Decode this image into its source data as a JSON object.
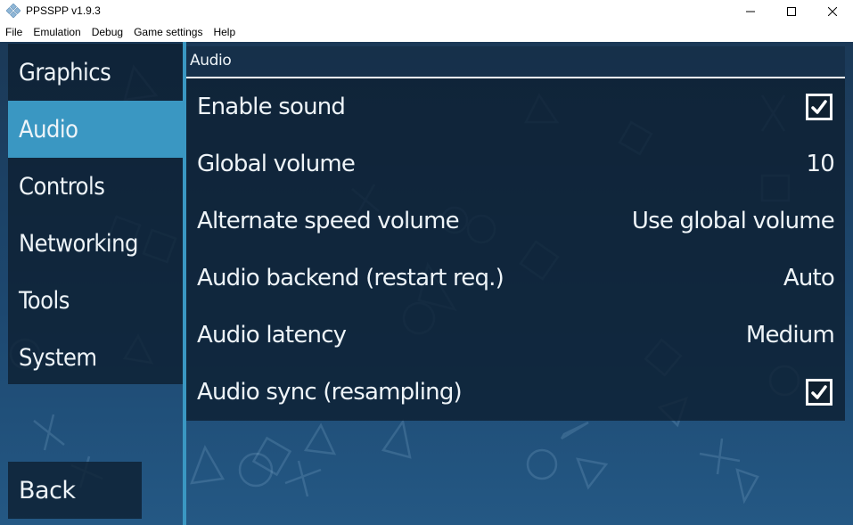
{
  "window": {
    "title": "PPSSPP v1.9.3",
    "app_icon": "ppsspp-logo-icon",
    "controls": {
      "minimize": "minimize-icon",
      "maximize": "maximize-icon",
      "close": "close-icon"
    }
  },
  "menubar": {
    "items": [
      "File",
      "Emulation",
      "Debug",
      "Game settings",
      "Help"
    ]
  },
  "sidebar": {
    "tabs": [
      {
        "label": "Graphics",
        "active": false
      },
      {
        "label": "Audio",
        "active": true
      },
      {
        "label": "Controls",
        "active": false
      },
      {
        "label": "Networking",
        "active": false
      },
      {
        "label": "Tools",
        "active": false
      },
      {
        "label": "System",
        "active": false
      }
    ],
    "back_label": "Back"
  },
  "section": {
    "title": "Audio"
  },
  "settings": [
    {
      "label": "Enable sound",
      "type": "checkbox",
      "checked": true
    },
    {
      "label": "Global volume",
      "type": "value",
      "value": "10"
    },
    {
      "label": "Alternate speed volume",
      "type": "value",
      "value": "Use global volume"
    },
    {
      "label": "Audio backend (restart req.)",
      "type": "value",
      "value": "Auto"
    },
    {
      "label": "Audio latency",
      "type": "value",
      "value": "Medium"
    },
    {
      "label": "Audio sync (resampling)",
      "type": "checkbox",
      "checked": true
    }
  ],
  "colors": {
    "accent": "#3a97c2",
    "panel": "#0e2032",
    "background_top": "#1b3957",
    "background_bottom": "#245884",
    "text": "#eef4f8"
  }
}
